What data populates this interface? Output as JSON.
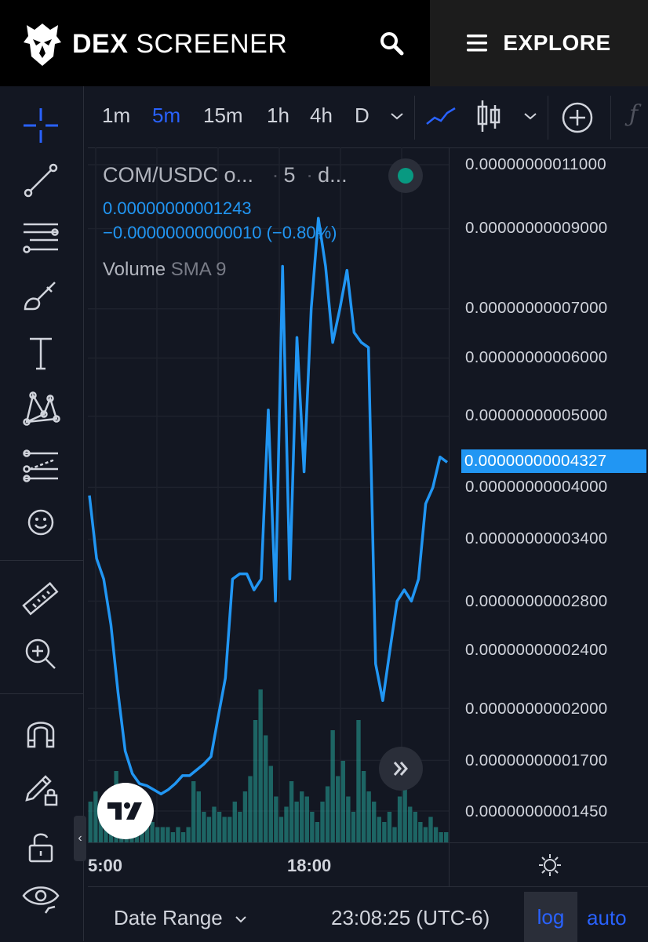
{
  "header": {
    "brand_bold": "DEX",
    "brand_light": "SCREENER",
    "explore_label": "EXPLORE"
  },
  "toolbar": {
    "timeframes": [
      "1m",
      "5m",
      "15m",
      "1h",
      "4h",
      "D"
    ],
    "active_timeframe": "5m"
  },
  "legend": {
    "symbol": "COM/USDC o...",
    "interval": "5",
    "exchange": "d...",
    "price": "0.00000000001243",
    "change": "−0.00000000000010 (−0.80%)",
    "volume_label": "Volume",
    "volume_indicator": "SMA 9"
  },
  "price_axis": {
    "labels": [
      "0.00000000011000",
      "0.00000000009000",
      "0.00000000007000",
      "0.00000000006000",
      "0.00000000005000",
      "0.00000000004000",
      "0.00000000003400",
      "0.00000000002800",
      "0.00000000002400",
      "0.00000000002000",
      "0.00000000001700",
      "0.00000000001450"
    ],
    "current_price": "0.00000000004327",
    "scale": "log"
  },
  "time_axis": {
    "labels": [
      "5:00",
      "18:00"
    ]
  },
  "bottom": {
    "date_range_label": "Date Range",
    "clock": "23:08:25 (UTC-6)",
    "log_label": "log",
    "auto_label": "auto"
  },
  "colors": {
    "background": "#131722",
    "line": "#2196f3",
    "volume": "#26a69a",
    "accent": "#2962ff"
  },
  "chart_data": {
    "type": "line",
    "series": [
      {
        "values": [
          3.9e-11,
          3.2e-11,
          3e-11,
          2.6e-11,
          2.1e-11,
          1.75e-11,
          1.63e-11,
          1.58e-11,
          1.57e-11,
          1.55e-11,
          1.53e-11,
          1.55e-11,
          1.58e-11,
          1.62e-11,
          1.62e-11,
          1.65e-11,
          1.68e-11,
          1.72e-11,
          1.95e-11,
          2.2e-11,
          3e-11,
          3.05e-11,
          3.05e-11,
          2.9e-11,
          3e-11,
          5.1e-11,
          2.8e-11,
          8e-11,
          3e-11,
          6.4e-11,
          4.2e-11,
          7e-11,
          9.3e-11,
          8e-11,
          6.3e-11,
          7e-11,
          7.9e-11,
          6.5e-11,
          6.3e-11,
          6.2e-11,
          2.3e-11,
          2.05e-11,
          2.4e-11,
          2.8e-11,
          2.9e-11,
          2.8e-11,
          3e-11,
          3.8e-11,
          4e-11,
          4.4e-11,
          4.327e-11
        ]
      }
    ],
    "volume": [
      8,
      10,
      7,
      6,
      8,
      14,
      10,
      11,
      9,
      5,
      3,
      3,
      4,
      3,
      3,
      3,
      2,
      3,
      2,
      3,
      12,
      10,
      6,
      5,
      7,
      6,
      5,
      5,
      8,
      6,
      10,
      13,
      24,
      30,
      21,
      15,
      9,
      5,
      7,
      12,
      8,
      10,
      9,
      6,
      4,
      8,
      11,
      22,
      13,
      16,
      9,
      6,
      24,
      14,
      10,
      8,
      5,
      4,
      6,
      3,
      9,
      13,
      7,
      6,
      4,
      3,
      5,
      3,
      2,
      2
    ],
    "ylim": [
      1.4e-11,
      1.15e-10
    ],
    "x_ticks": [
      "5:00",
      "18:00"
    ]
  }
}
